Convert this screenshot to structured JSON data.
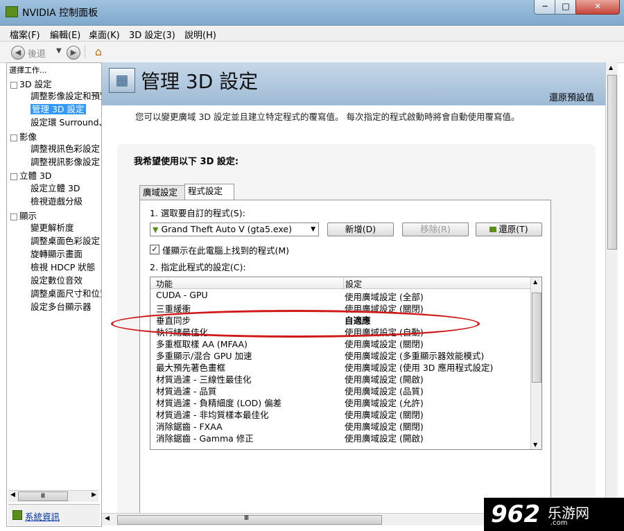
{
  "window": {
    "title": "NVIDIA 控制面板",
    "min": "─",
    "max": "□",
    "close": "✕"
  },
  "menu": [
    "檔案(F)",
    "編輯(E)",
    "桌面(K)",
    "3D 設定(3)",
    "說明(H)"
  ],
  "toolbar": {
    "back_label": "後退",
    "back_glyph": "◀",
    "forward_glyph": "▶",
    "drop_glyph": "▼",
    "home_glyph": "⌂"
  },
  "sidebar": {
    "header": "選擇工作...",
    "items": [
      {
        "label": "3D 設定",
        "level": 0
      },
      {
        "label": "調整影像設定和預覽",
        "level": 1
      },
      {
        "label": "管理 3D 設定",
        "level": 1,
        "selected": true
      },
      {
        "label": "設定環 Surround、PhysX",
        "level": 1
      },
      {
        "label": "影像",
        "level": 0
      },
      {
        "label": "調整視訊色彩設定",
        "level": 1
      },
      {
        "label": "調整視訊影像設定",
        "level": 1
      },
      {
        "label": "立體 3D",
        "level": 0
      },
      {
        "label": "設定立體 3D",
        "level": 1
      },
      {
        "label": "檢視遊戲分級",
        "level": 1
      },
      {
        "label": "顯示",
        "level": 0
      },
      {
        "label": "變更解析度",
        "level": 1
      },
      {
        "label": "調整桌面色彩設定",
        "level": 1
      },
      {
        "label": "旋轉顯示畫面",
        "level": 1
      },
      {
        "label": "檢視 HDCP 狀態",
        "level": 1
      },
      {
        "label": "設定數位音效",
        "level": 1
      },
      {
        "label": "調整桌面尺寸和位置",
        "level": 1
      },
      {
        "label": "設定多台顯示器",
        "level": 1
      }
    ],
    "footer_link": "系統資訊"
  },
  "banner": {
    "title": "管理 3D 設定",
    "restore": "還原預設值",
    "icon_glyph": "▦"
  },
  "description": "您可以變更廣域 3D 設定並且建立特定程式的覆寫值。 每次指定的程式啟動時將會自動使用覆寫值。",
  "panel": {
    "heading": "我希望使用以下 3D 設定:",
    "tabs": [
      "廣域設定",
      "程式設定"
    ],
    "step1": "1. 選取要自訂的程式(S):",
    "program": "Grand Theft Auto V (gta5.exe)",
    "program_icon": "▼",
    "select_arrow": "▼",
    "buttons": {
      "add": "新增(D)",
      "remove": "移除(R)",
      "restore": "還原(T)"
    },
    "checkbox": {
      "checked": true,
      "mark": "✓",
      "label": "僅顯示在此電腦上找到的程式(M)"
    },
    "step2": "2. 指定此程式的設定(C):",
    "columns": [
      "功能",
      "設定"
    ],
    "rows": [
      {
        "feature": "CUDA - GPU",
        "setting": "使用廣域設定 (全部)"
      },
      {
        "feature": "三重緩衝",
        "setting": "使用廣域設定 (關閉)"
      },
      {
        "feature": "垂直同步",
        "setting": "自適應",
        "bold": true
      },
      {
        "feature": "執行緒最佳化",
        "setting": "使用廣域設定 (自動)"
      },
      {
        "feature": "多重框取樣 AA (MFAA)",
        "setting": "使用廣域設定 (關閉)"
      },
      {
        "feature": "多重顯示/混合 GPU 加速",
        "setting": "使用廣域設定 (多重顯示器效能模式)"
      },
      {
        "feature": "最大預先著色畫框",
        "setting": "使用廣域設定 (使用 3D 應用程式設定)"
      },
      {
        "feature": "材質過濾 - 三線性最佳化",
        "setting": "使用廣域設定 (開啟)"
      },
      {
        "feature": "材質過濾 - 品質",
        "setting": "使用廣域設定 (品質)"
      },
      {
        "feature": "材質過濾 - 負精細度 (LOD) 偏差",
        "setting": "使用廣域設定 (允許)"
      },
      {
        "feature": "材質過濾 - 非均質樣本最佳化",
        "setting": "使用廣域設定 (關閉)"
      },
      {
        "feature": "消除鋸齒 - FXAA",
        "setting": "使用廣域設定 (關閉)"
      },
      {
        "feature": "消除鋸齒 - Gamma 修正",
        "setting": "使用廣域設定 (開啟)"
      }
    ],
    "scroll_up": "▲",
    "scroll_down": "▼"
  },
  "scrollbars": {
    "grip": "Ⅲ",
    "left": "◀",
    "right": "▶"
  },
  "watermark": {
    "number": "962",
    "name": "乐游网",
    "url": ".com"
  },
  "colors": {
    "highlight": "#d01a1a",
    "selection": "#3399ff",
    "nvidia_green": "#5b8e1a"
  }
}
